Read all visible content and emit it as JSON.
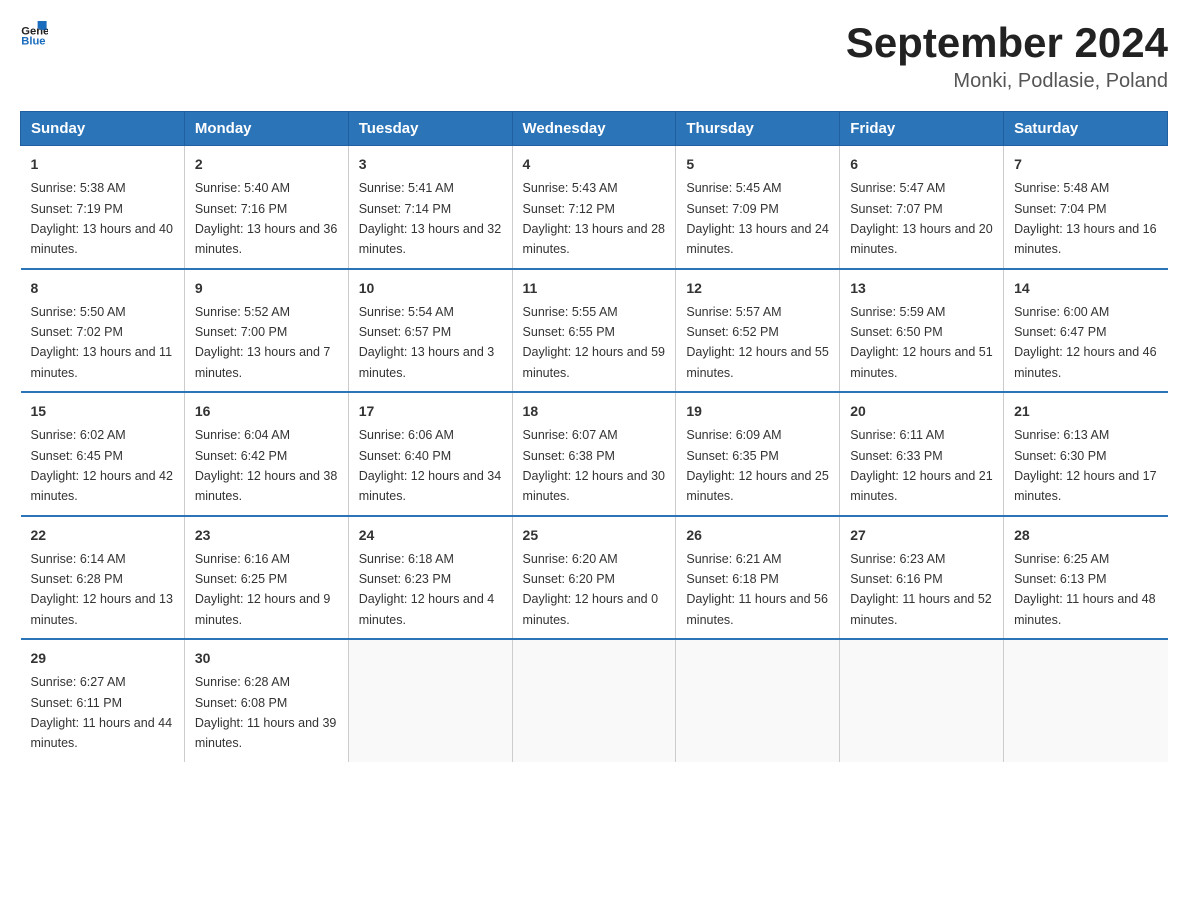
{
  "logo": {
    "text_general": "General",
    "text_blue": "Blue"
  },
  "title": "September 2024",
  "subtitle": "Monki, Podlasie, Poland",
  "headers": [
    "Sunday",
    "Monday",
    "Tuesday",
    "Wednesday",
    "Thursday",
    "Friday",
    "Saturday"
  ],
  "weeks": [
    [
      {
        "day": "1",
        "sunrise": "5:38 AM",
        "sunset": "7:19 PM",
        "daylight": "13 hours and 40 minutes."
      },
      {
        "day": "2",
        "sunrise": "5:40 AM",
        "sunset": "7:16 PM",
        "daylight": "13 hours and 36 minutes."
      },
      {
        "day": "3",
        "sunrise": "5:41 AM",
        "sunset": "7:14 PM",
        "daylight": "13 hours and 32 minutes."
      },
      {
        "day": "4",
        "sunrise": "5:43 AM",
        "sunset": "7:12 PM",
        "daylight": "13 hours and 28 minutes."
      },
      {
        "day": "5",
        "sunrise": "5:45 AM",
        "sunset": "7:09 PM",
        "daylight": "13 hours and 24 minutes."
      },
      {
        "day": "6",
        "sunrise": "5:47 AM",
        "sunset": "7:07 PM",
        "daylight": "13 hours and 20 minutes."
      },
      {
        "day": "7",
        "sunrise": "5:48 AM",
        "sunset": "7:04 PM",
        "daylight": "13 hours and 16 minutes."
      }
    ],
    [
      {
        "day": "8",
        "sunrise": "5:50 AM",
        "sunset": "7:02 PM",
        "daylight": "13 hours and 11 minutes."
      },
      {
        "day": "9",
        "sunrise": "5:52 AM",
        "sunset": "7:00 PM",
        "daylight": "13 hours and 7 minutes."
      },
      {
        "day": "10",
        "sunrise": "5:54 AM",
        "sunset": "6:57 PM",
        "daylight": "13 hours and 3 minutes."
      },
      {
        "day": "11",
        "sunrise": "5:55 AM",
        "sunset": "6:55 PM",
        "daylight": "12 hours and 59 minutes."
      },
      {
        "day": "12",
        "sunrise": "5:57 AM",
        "sunset": "6:52 PM",
        "daylight": "12 hours and 55 minutes."
      },
      {
        "day": "13",
        "sunrise": "5:59 AM",
        "sunset": "6:50 PM",
        "daylight": "12 hours and 51 minutes."
      },
      {
        "day": "14",
        "sunrise": "6:00 AM",
        "sunset": "6:47 PM",
        "daylight": "12 hours and 46 minutes."
      }
    ],
    [
      {
        "day": "15",
        "sunrise": "6:02 AM",
        "sunset": "6:45 PM",
        "daylight": "12 hours and 42 minutes."
      },
      {
        "day": "16",
        "sunrise": "6:04 AM",
        "sunset": "6:42 PM",
        "daylight": "12 hours and 38 minutes."
      },
      {
        "day": "17",
        "sunrise": "6:06 AM",
        "sunset": "6:40 PM",
        "daylight": "12 hours and 34 minutes."
      },
      {
        "day": "18",
        "sunrise": "6:07 AM",
        "sunset": "6:38 PM",
        "daylight": "12 hours and 30 minutes."
      },
      {
        "day": "19",
        "sunrise": "6:09 AM",
        "sunset": "6:35 PM",
        "daylight": "12 hours and 25 minutes."
      },
      {
        "day": "20",
        "sunrise": "6:11 AM",
        "sunset": "6:33 PM",
        "daylight": "12 hours and 21 minutes."
      },
      {
        "day": "21",
        "sunrise": "6:13 AM",
        "sunset": "6:30 PM",
        "daylight": "12 hours and 17 minutes."
      }
    ],
    [
      {
        "day": "22",
        "sunrise": "6:14 AM",
        "sunset": "6:28 PM",
        "daylight": "12 hours and 13 minutes."
      },
      {
        "day": "23",
        "sunrise": "6:16 AM",
        "sunset": "6:25 PM",
        "daylight": "12 hours and 9 minutes."
      },
      {
        "day": "24",
        "sunrise": "6:18 AM",
        "sunset": "6:23 PM",
        "daylight": "12 hours and 4 minutes."
      },
      {
        "day": "25",
        "sunrise": "6:20 AM",
        "sunset": "6:20 PM",
        "daylight": "12 hours and 0 minutes."
      },
      {
        "day": "26",
        "sunrise": "6:21 AM",
        "sunset": "6:18 PM",
        "daylight": "11 hours and 56 minutes."
      },
      {
        "day": "27",
        "sunrise": "6:23 AM",
        "sunset": "6:16 PM",
        "daylight": "11 hours and 52 minutes."
      },
      {
        "day": "28",
        "sunrise": "6:25 AM",
        "sunset": "6:13 PM",
        "daylight": "11 hours and 48 minutes."
      }
    ],
    [
      {
        "day": "29",
        "sunrise": "6:27 AM",
        "sunset": "6:11 PM",
        "daylight": "11 hours and 44 minutes."
      },
      {
        "day": "30",
        "sunrise": "6:28 AM",
        "sunset": "6:08 PM",
        "daylight": "11 hours and 39 minutes."
      },
      null,
      null,
      null,
      null,
      null
    ]
  ]
}
